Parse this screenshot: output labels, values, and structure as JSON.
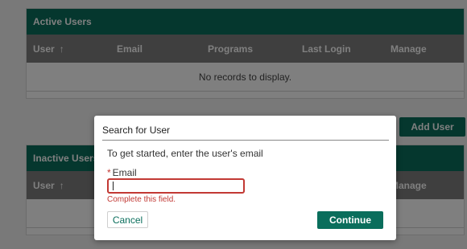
{
  "active_users": {
    "title": "Active Users",
    "columns": [
      "User",
      "Email",
      "Programs",
      "Last Login",
      "Manage"
    ],
    "sort_icon": "↑",
    "empty_message": "No records to display."
  },
  "inactive_users": {
    "title": "Inactive Users",
    "columns": [
      "User",
      "Manage"
    ],
    "sort_icon": "↑"
  },
  "add_user_label": "Add User",
  "modal": {
    "title": "Search for User",
    "instructions": "To get started, enter the user's email",
    "required_mark": "*",
    "email_label": "Email",
    "email_value": "",
    "error": "Complete this field.",
    "cancel_label": "Cancel",
    "continue_label": "Continue"
  },
  "colors": {
    "brand": "#0a6e5c",
    "header_bar": "#7e7e7e",
    "error": "#c23934"
  }
}
